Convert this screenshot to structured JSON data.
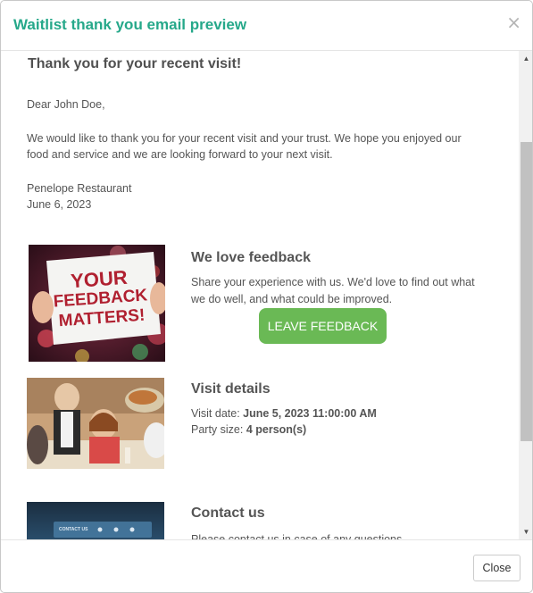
{
  "modal": {
    "title": "Waitlist thank you email preview",
    "close_glyph": "×"
  },
  "email": {
    "heading": "Thank you for your recent visit!",
    "salutation": "Dear John Doe,",
    "body_line1": "We would like to thank you for your recent visit and your trust. We hope you enjoyed our",
    "body_line2": "food and service and we are looking forward to your next visit.",
    "signature_name": "Penelope Restaurant",
    "signature_date": "June 6, 2023"
  },
  "feedback": {
    "image_text_line1": "YOUR",
    "image_text_line2": "FEEDBACK",
    "image_text_line3": "MATTERS!",
    "title": "We love feedback",
    "text_line1": "Share your experience with us. We'd love to find out what",
    "text_line2": "we do well, and what could be improved.",
    "button_label": "LEAVE FEEDBACK"
  },
  "visit": {
    "title": "Visit details",
    "date_label": "Visit date: ",
    "date_value": "June 5, 2023 11:00:00 AM",
    "party_label": "Party size: ",
    "party_value": "4 person(s)"
  },
  "contact": {
    "title": "Contact us",
    "image_label": "CONTACT US",
    "text": "Please contact us in case of any questions."
  },
  "footer": {
    "close_label": "Close"
  },
  "colors": {
    "title": "#26a88a",
    "button": "#6ab955",
    "text": "#555555"
  },
  "icons": {
    "close": "close-icon",
    "scroll_up": "caret-up-icon",
    "scroll_down": "caret-down-icon"
  }
}
